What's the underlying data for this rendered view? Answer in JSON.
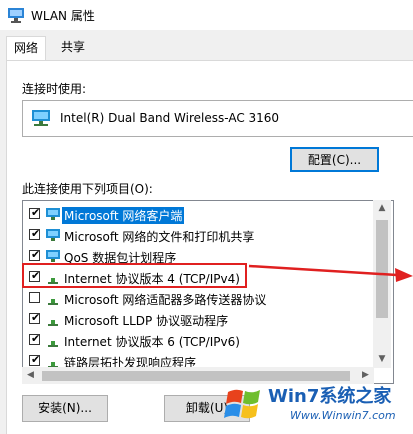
{
  "window": {
    "title": "WLAN 属性"
  },
  "tabs": [
    {
      "label": "网络",
      "active": true
    },
    {
      "label": "共享",
      "active": false
    }
  ],
  "connect_using": {
    "label": "连接时使用:",
    "adapter_name": "Intel(R) Dual Band Wireless-AC 3160",
    "adapter_icon": "network-adapter-icon"
  },
  "buttons": {
    "configure": "配置(C)...",
    "install": "安装(N)...",
    "uninstall": "卸载(U)"
  },
  "items_label": "此连接使用下列项目(O):",
  "items": [
    {
      "label": "Microsoft 网络客户端",
      "checked": true,
      "icon": "network-client-icon",
      "selected": true
    },
    {
      "label": "Microsoft 网络的文件和打印机共享",
      "checked": true,
      "icon": "network-client-icon",
      "selected": false
    },
    {
      "label": "QoS 数据包计划程序",
      "checked": true,
      "icon": "network-client-icon",
      "selected": false
    },
    {
      "label": "Internet 协议版本 4 (TCP/IPv4)",
      "checked": true,
      "icon": "protocol-icon",
      "selected": false,
      "highlighted": true
    },
    {
      "label": "Microsoft 网络适配器多路传送器协议",
      "checked": false,
      "icon": "protocol-icon",
      "selected": false
    },
    {
      "label": "Microsoft LLDP 协议驱动程序",
      "checked": true,
      "icon": "protocol-icon",
      "selected": false
    },
    {
      "label": "Internet 协议版本 6 (TCP/IPv6)",
      "checked": true,
      "icon": "protocol-icon",
      "selected": false
    },
    {
      "label": "链路层拓扑发现响应程序",
      "checked": true,
      "icon": "protocol-icon",
      "selected": false
    }
  ],
  "annotation": {
    "highlight_color": "#e02020"
  },
  "watermark": {
    "main": "Win7系统之家",
    "sub": "Www.Winwin7.com"
  },
  "colors": {
    "accent": "#0078d7",
    "dialog_bg": "#f0f0f0",
    "annotation_red": "#e02020"
  }
}
